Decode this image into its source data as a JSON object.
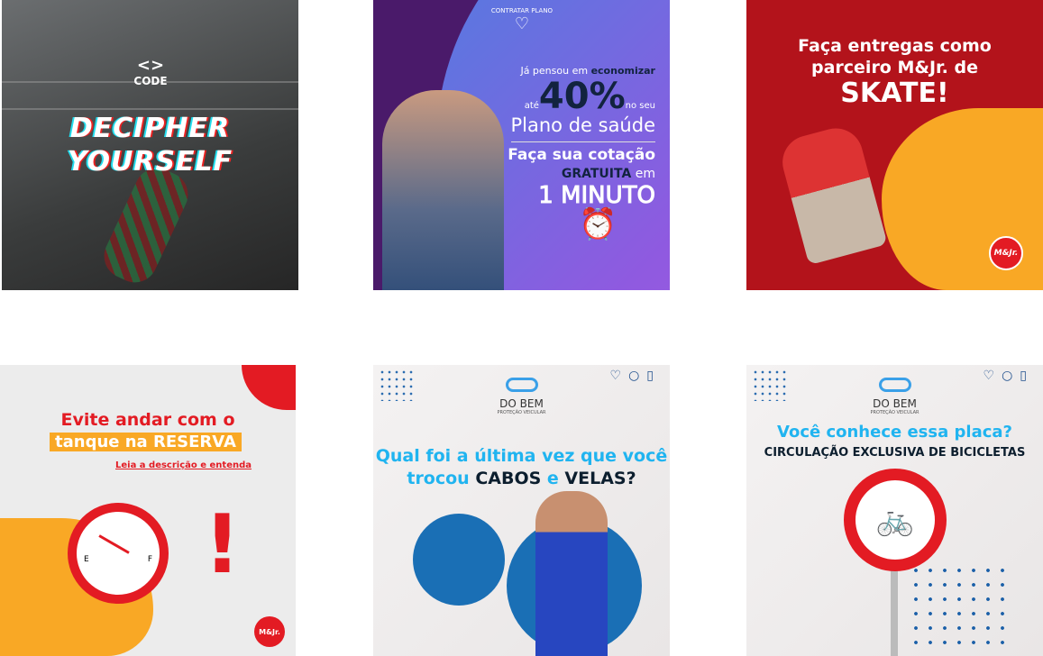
{
  "posts": [
    {
      "logo": "CODE",
      "title_line1": "DECIPHER",
      "title_line2": "YOURSELF"
    },
    {
      "badge": "CONTRATAR PLANO",
      "line1_a": "Já pensou em ",
      "line1_b": "economizar",
      "ate": "até",
      "percent": "40%",
      "no_seu": "no seu",
      "plano": "Plano de saúde",
      "faca": "Faça sua cotação",
      "gratuita": "GRATUITA",
      "em": "em",
      "minuto": "1 MINUTO"
    },
    {
      "line1": "Faça entregas como",
      "line2": "parceiro M&Jr. de",
      "line3": "SKATE!",
      "brand": "M&Jr."
    },
    {
      "line1": "Evite andar com o",
      "line2": "tanque na RESERVA",
      "link": "Leia a descrição e entenda",
      "gauge_e": "E",
      "gauge_f": "F",
      "brand": "M&Jr."
    },
    {
      "brand": "DO BEM",
      "brand_sub": "PROTEÇÃO VEICULAR",
      "q1": "Qual foi a última vez que você",
      "q2a": "trocou ",
      "q2b": "CABOS",
      "q2c": " e ",
      "q2d": "VELAS?"
    },
    {
      "brand": "DO BEM",
      "brand_sub": "PROTEÇÃO VEICULAR",
      "q1": "Você conhece essa placa?",
      "q2": "CIRCULAÇÃO EXCLUSIVA DE BICICLETAS"
    }
  ],
  "colors": {
    "red": "#e31b23",
    "orange": "#f9a825",
    "blue": "#20b4f0",
    "purple": "#8f5ae0"
  }
}
